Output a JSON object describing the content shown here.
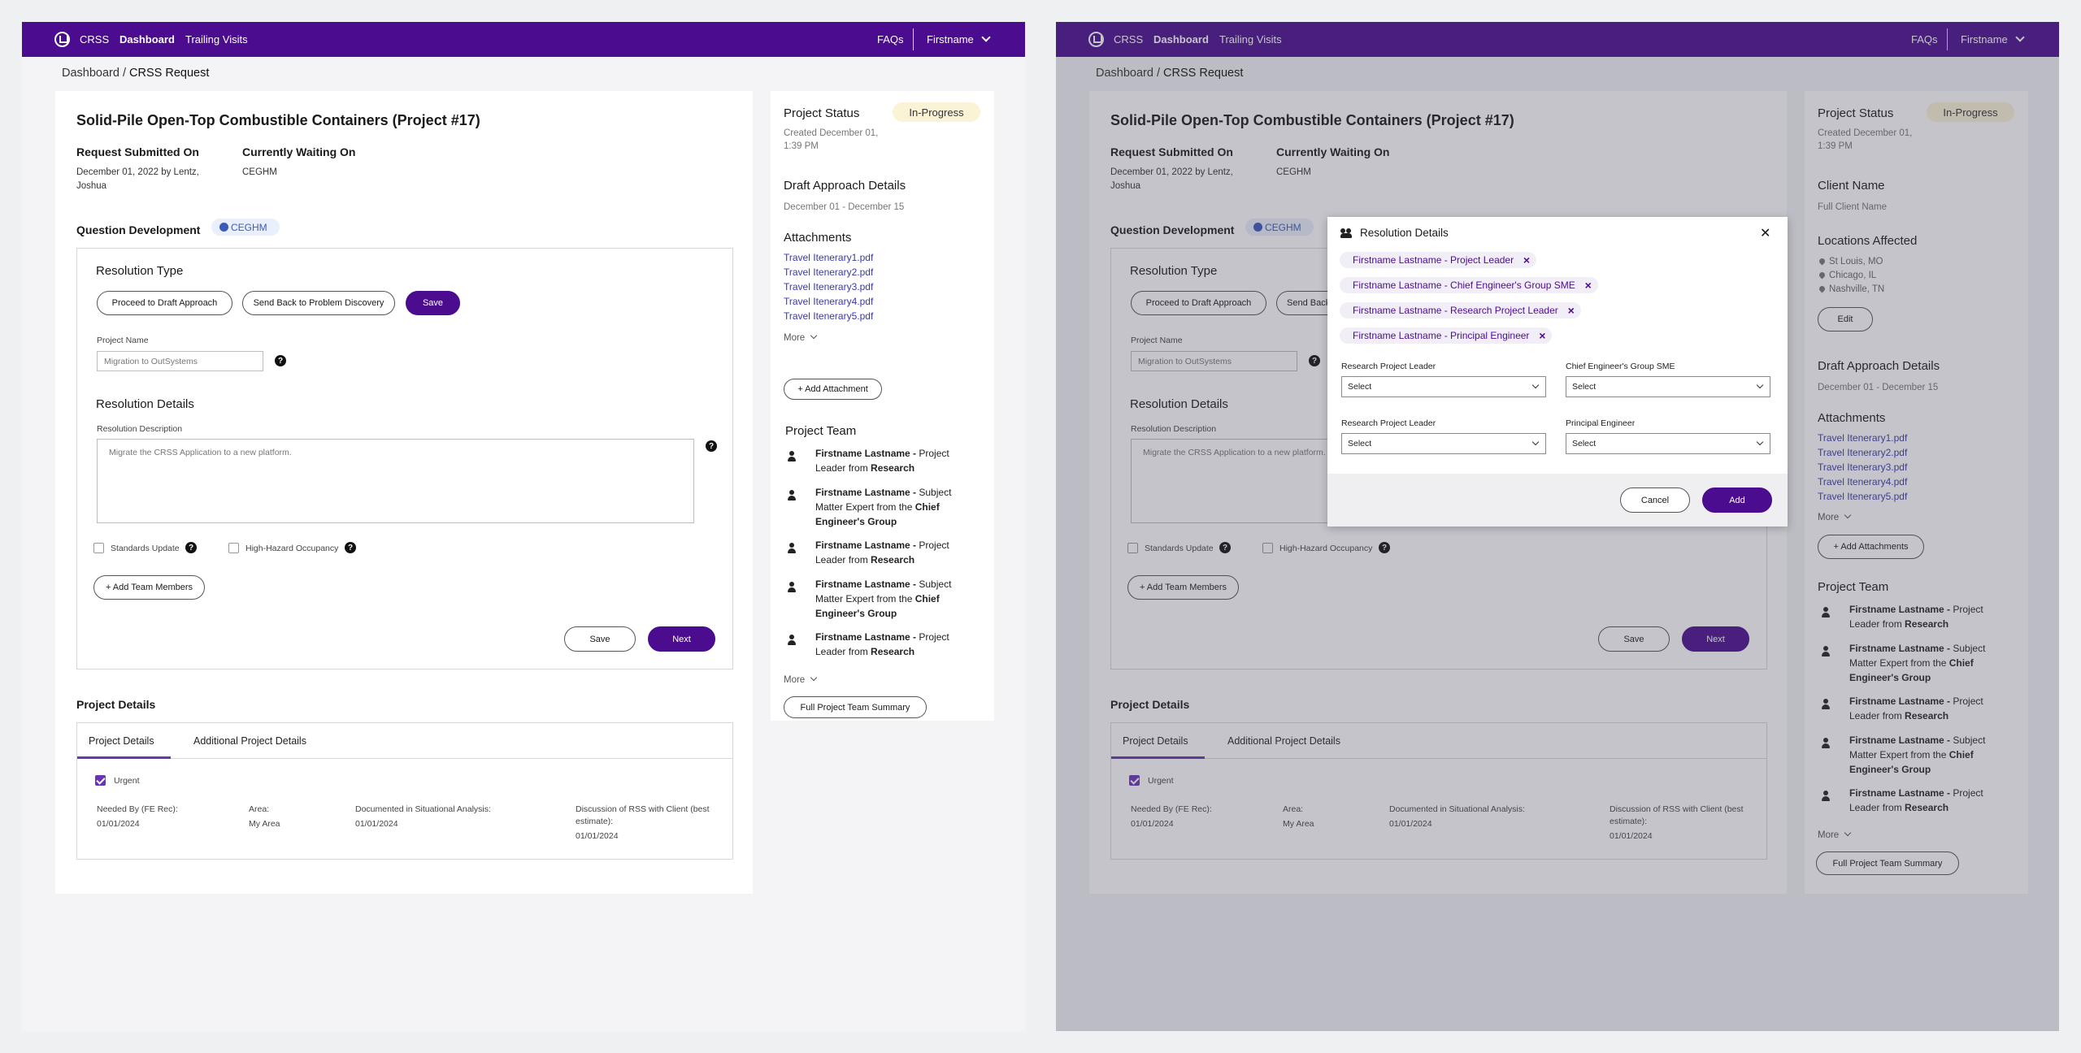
{
  "nav": {
    "brand": "CRSS",
    "dashboard": "Dashboard",
    "trailing_visits": "Trailing Visits",
    "faqs": "FAQs",
    "user": "Firstname"
  },
  "breadcrumb": {
    "parent": "Dashboard",
    "sep": " / ",
    "current": "CRSS Request"
  },
  "request": {
    "title": "Solid-Pile Open-Top Combustible Containers (Project #17)",
    "submitted_label": "Request Submitted On",
    "submitted_value_l1": "December 01, 2022 by Lentz,",
    "submitted_value_l2": "Joshua",
    "waiting_label": "Currently Waiting On",
    "waiting_value": "CEGHM"
  },
  "question_dev": {
    "title": "Question Development",
    "tag": "CEGHM"
  },
  "resolution_type": {
    "title": "Resolution Type",
    "btn_proceed": "Proceed to Draft Approach",
    "btn_send_back": "Send Back to Problem Discovery",
    "btn_send_back_trunc": "Send Back",
    "btn_save": "Save"
  },
  "project_name": {
    "label": "Project Name",
    "placeholder": "Migration to OutSystems",
    "help": "?"
  },
  "resolution_details": {
    "title": "Resolution Details",
    "desc_label": "Resolution Description",
    "desc_value": "Migrate the CRSS Application to a new platform."
  },
  "checks": {
    "standards": "Standards Update",
    "hazard": "High-Hazard Occupancy"
  },
  "add_team_members": "+ Add Team Members",
  "footer_buttons": {
    "save": "Save",
    "next": "Next"
  },
  "project_details": {
    "title": "Project Details",
    "tabs": [
      "Project Details",
      "Additional Project Details"
    ],
    "urgent": "Urgent",
    "fields": [
      {
        "label": "Needed By (FE Rec):",
        "value": "01/01/2024"
      },
      {
        "label": "Area:",
        "value": "My Area"
      },
      {
        "label": "Documented in Situational Analysis:",
        "value": "01/01/2024"
      },
      {
        "label_l1": "Discussion of RSS with Client (best",
        "label_l2": "estimate):",
        "value": "01/01/2024"
      }
    ]
  },
  "side": {
    "status_title": "Project Status",
    "status_badge": "In-Progress",
    "created_l1": "Created December 01,",
    "created_l2": "1:39 PM",
    "draft_title": "Draft Approach Details",
    "draft_dates": "December 01 - December 15",
    "attachments_title": "Attachments",
    "attachments": [
      "Travel Itenerary1.pdf",
      "Travel Itenerary2.pdf",
      "Travel Itenerary3.pdf",
      "Travel Itenerary4.pdf",
      "Travel Itenerary5.pdf"
    ],
    "more": "More",
    "add_attachment": "+ Add Attachment",
    "add_attachments": "+ Add Attachments",
    "team_title": "Project Team",
    "team": [
      {
        "name": "Firstname Lastname -",
        "l1": " Project",
        "l2": "Leader from ",
        "org": "Research",
        "l3": ""
      },
      {
        "name": "Firstname Lastname -",
        "l1": " Subject",
        "l2": "Matter Expert from the ",
        "org": "Chief",
        "l3": "Engineer's Group"
      },
      {
        "name": "Firstname Lastname -",
        "l1": " Project",
        "l2": "Leader from ",
        "org": "Research",
        "l3": ""
      },
      {
        "name": "Firstname Lastname -",
        "l1": " Subject",
        "l2": "Matter Expert from the ",
        "org": "Chief",
        "l3": "Engineer's Group"
      },
      {
        "name": "Firstname Lastname -",
        "l1": " Project",
        "l2": "Leader from ",
        "org": "Research",
        "l3": ""
      }
    ],
    "full_team": "Full Project Team Summary",
    "client_title": "Client Name",
    "client_value": "Full Client Name",
    "locations_title": "Locations Affected",
    "locations": [
      "St Louis, MO",
      "Chicago, IL",
      "Nashville, TN"
    ],
    "edit": "Edit"
  },
  "modal": {
    "title": "Resolution Details",
    "chips": [
      "Firstname Lastname - Project Leader",
      "Firstname Lastname - Chief Engineer's Group SME",
      "Firstname Lastname - Research Project Leader",
      "Firstname Lastname - Principal Engineer"
    ],
    "fields": [
      {
        "label": "Research Project Leader",
        "value": "Select"
      },
      {
        "label": "Chief Engineer's Group SME",
        "value": "Select"
      },
      {
        "label": "Research Project Leader",
        "value": "Select"
      },
      {
        "label": "Principal Engineer",
        "value": "Select"
      }
    ],
    "cancel": "Cancel",
    "add": "Add",
    "close": "✕"
  }
}
